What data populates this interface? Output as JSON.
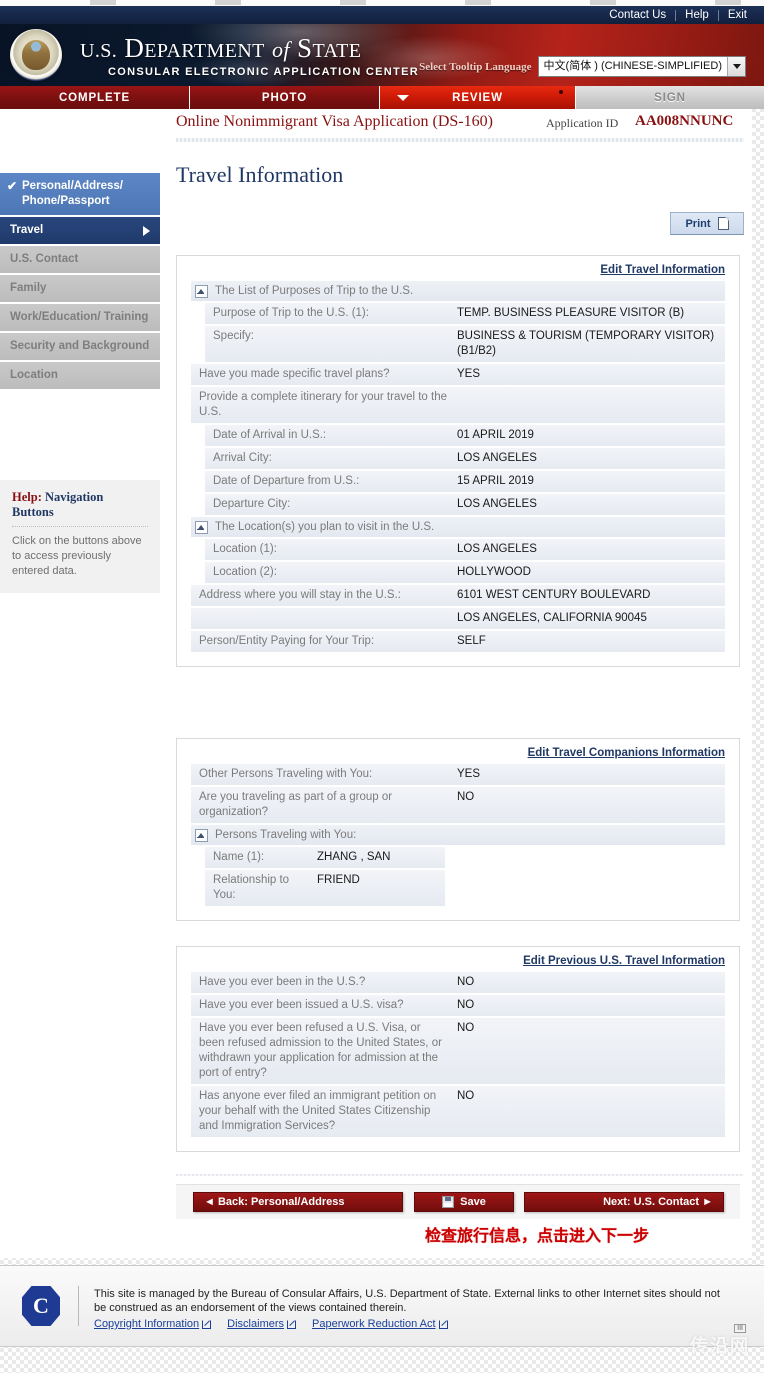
{
  "browser": {
    "tab_count": 6
  },
  "topbar": {
    "links": [
      "Contact Us",
      "Help",
      "Exit"
    ]
  },
  "masthead": {
    "title_us": "U.S.",
    "title_department": "D",
    "title_department_rest": "EPARTMENT",
    "title_of": "of",
    "title_state": "S",
    "title_state_rest": "TATE",
    "subtitle": "CONSULAR ELECTRONIC APPLICATION CENTER",
    "language_label": "Select Tooltip Language",
    "language_value": "中文(简体 ) (CHINESE-SIMPLIFIED)",
    "seal_icon": "us-great-seal-icon",
    "dropdown_icon": "chevron-down-icon"
  },
  "tabs": [
    {
      "label": "COMPLETE",
      "state": "done"
    },
    {
      "label": "PHOTO",
      "state": "done"
    },
    {
      "label": "REVIEW",
      "state": "active"
    },
    {
      "label": "SIGN",
      "state": "off"
    }
  ],
  "app": {
    "name": "Online Nonimmigrant Visa Application (DS-160)",
    "id_label": "Application ID",
    "id_value": "AA008NNUNC",
    "page_title": "Travel Information",
    "print_label": "Print",
    "print_icon": "document-icon"
  },
  "sidebar": {
    "items": [
      {
        "label": "Personal/Address/ Phone/Passport",
        "state": "visited",
        "check_icon": "check-icon"
      },
      {
        "label": "Travel",
        "state": "current",
        "arrow_icon": "arrow-right-icon"
      },
      {
        "label": "U.S. Contact",
        "state": "locked"
      },
      {
        "label": "Family",
        "state": "locked"
      },
      {
        "label": "Work/Education/ Training",
        "state": "locked"
      },
      {
        "label": "Security and Background",
        "state": "locked"
      },
      {
        "label": "Location",
        "state": "locked"
      }
    ],
    "help": {
      "title_lead": "Help:",
      "title_rest": " Navigation Buttons",
      "body": "Click on the buttons above to access previously entered data."
    }
  },
  "panels": [
    {
      "edit_link": "Edit Travel Information",
      "rows": [
        {
          "type": "group",
          "label": "The List of Purposes of Trip to the U.S.",
          "icon": "collapse-icon"
        },
        {
          "type": "row",
          "indent": true,
          "label": "Purpose of Trip to the U.S. (1):",
          "value": "TEMP. BUSINESS PLEASURE VISITOR (B)"
        },
        {
          "type": "row",
          "indent": true,
          "label": "Specify:",
          "value": "BUSINESS & TOURISM (TEMPORARY VISITOR) (B1/B2)"
        },
        {
          "type": "row",
          "label": "Have you made specific travel plans?",
          "value": "YES"
        },
        {
          "type": "row",
          "label": "Provide a complete itinerary for your travel to the U.S.",
          "value": ""
        },
        {
          "type": "row",
          "indent": true,
          "label": "Date of Arrival in U.S.:",
          "value": "01 APRIL 2019"
        },
        {
          "type": "row",
          "indent": true,
          "label": "Arrival City:",
          "value": "LOS ANGELES"
        },
        {
          "type": "row",
          "indent": true,
          "label": "Date of Departure from U.S.:",
          "value": "15 APRIL 2019"
        },
        {
          "type": "row",
          "indent": true,
          "label": "Departure City:",
          "value": "LOS ANGELES"
        },
        {
          "type": "group",
          "label": "The Location(s) you plan to visit in the U.S.",
          "icon": "collapse-icon"
        },
        {
          "type": "row",
          "indent": true,
          "label": "Location (1):",
          "value": "LOS ANGELES"
        },
        {
          "type": "row",
          "indent": true,
          "label": "Location (2):",
          "value": "HOLLYWOOD"
        },
        {
          "type": "row",
          "label": "Address where you will stay in the U.S.:",
          "value": "6101 WEST CENTURY BOULEVARD"
        },
        {
          "type": "row",
          "label": "",
          "value": "LOS ANGELES, CALIFORNIA 90045"
        },
        {
          "type": "row",
          "label": "Person/Entity Paying for Your Trip:",
          "value": "SELF"
        }
      ]
    },
    {
      "edit_link": "Edit Travel Companions Information",
      "rows": [
        {
          "type": "row",
          "label": "Other Persons Traveling with You:",
          "value": "YES"
        },
        {
          "type": "row",
          "label": "Are you traveling as part of a group or organization?",
          "value": "NO"
        },
        {
          "type": "group",
          "label": "Persons Traveling with You:",
          "icon": "collapse-icon"
        },
        {
          "type": "row",
          "indent": true,
          "narrow": true,
          "label": "Name (1):",
          "value": "ZHANG , SAN"
        },
        {
          "type": "row",
          "indent": true,
          "narrow": true,
          "label": "Relationship to You:",
          "value": "FRIEND"
        }
      ]
    },
    {
      "edit_link": "Edit Previous U.S. Travel Information",
      "rows": [
        {
          "type": "row",
          "label": "Have you ever been in the U.S.?",
          "value": "NO"
        },
        {
          "type": "row",
          "label": "Have you ever been issued a U.S. visa?",
          "value": "NO"
        },
        {
          "type": "row",
          "label": "Have you ever been refused a U.S. Visa, or been refused admission to the United States, or withdrawn your application for admission at the port of entry?",
          "value": "NO"
        },
        {
          "type": "row",
          "label": "Has anyone ever filed an immigrant petition on your behalf with the United States Citizenship and Immigration Services?",
          "value": "NO"
        }
      ]
    }
  ],
  "nav_buttons": {
    "back": "◄ Back: Personal/Address",
    "save": "Save",
    "save_icon": "save-disk-icon",
    "next": "Next: U.S. Contact ►"
  },
  "annotation": "检查旅行信息，点击进入下一步",
  "footer": {
    "seal_letter": "C",
    "seal_icon": "consular-affairs-seal-icon",
    "text": "This site is managed by the Bureau of Consular Affairs, U.S. Department of State. External links to other Internet sites should not be construed as an endorsement of the views contained therein.",
    "links": [
      {
        "label": "Copyright Information",
        "icon": "external-link-icon"
      },
      {
        "label": "Disclaimers",
        "icon": "external-link-icon"
      },
      {
        "label": "Paperwork Reduction Act",
        "icon": "external-link-icon"
      }
    ],
    "badge": "ІІІ"
  },
  "watermark": "传沿网"
}
